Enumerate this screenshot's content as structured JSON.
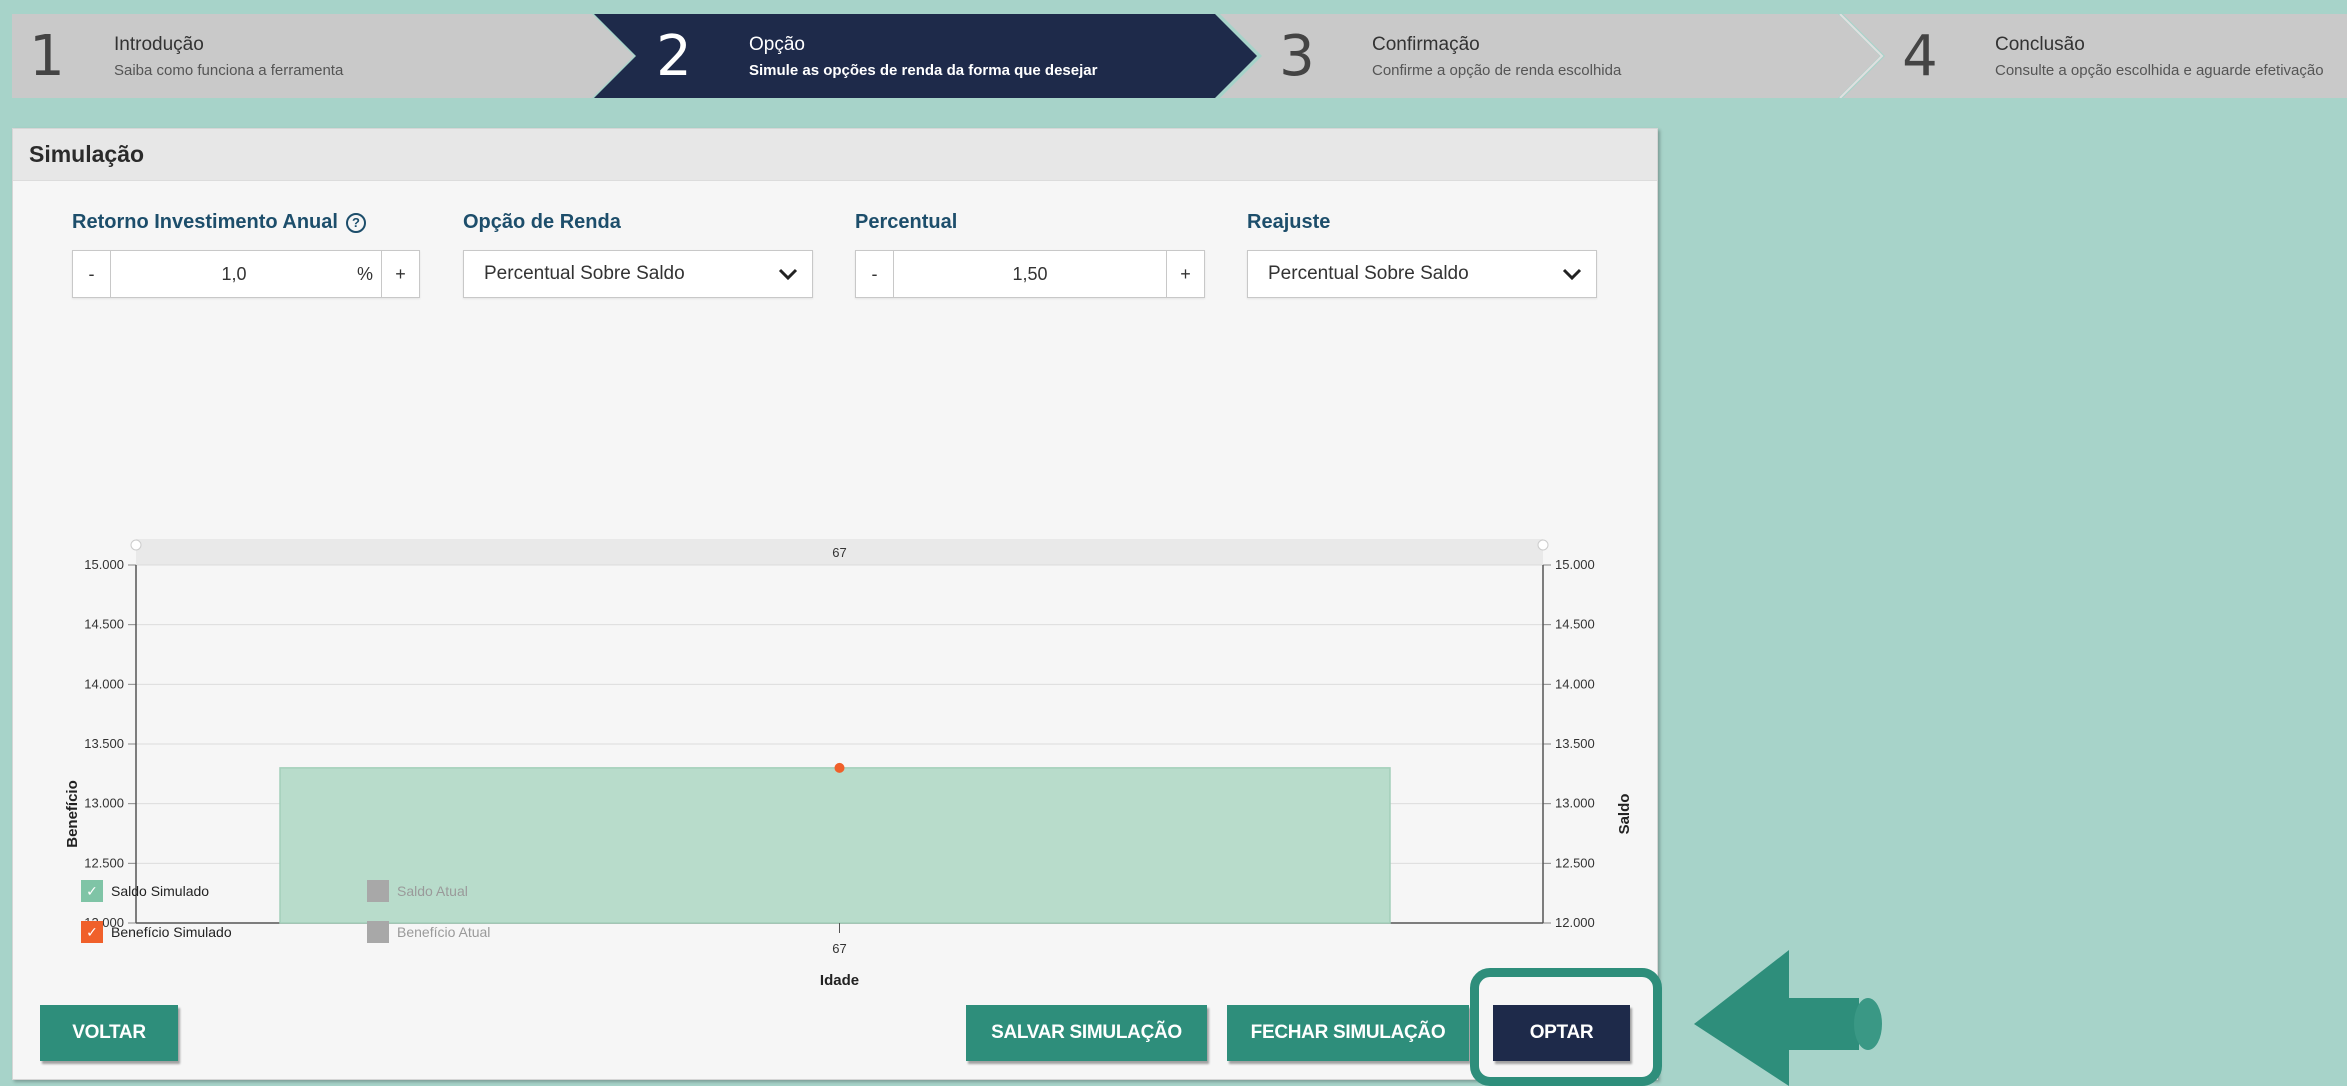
{
  "steps": [
    {
      "num": "1",
      "title": "Introdução",
      "sub": "Saiba como funciona a ferramenta"
    },
    {
      "num": "2",
      "title": "Opção",
      "sub": "Simule as opções de renda da forma que desejar"
    },
    {
      "num": "3",
      "title": "Confirmação",
      "sub": "Confirme a opção de renda escolhida"
    },
    {
      "num": "4",
      "title": "Conclusão",
      "sub": "Consulte a opção escolhida e aguarde efetivação"
    }
  ],
  "panel": {
    "title": "Simulação"
  },
  "fields": {
    "retorno": {
      "label": "Retorno Investimento Anual",
      "value": "1,0",
      "unit": "%",
      "minus": "-",
      "plus": "+"
    },
    "opcao": {
      "label": "Opção de Renda",
      "value": "Percentual Sobre Saldo"
    },
    "percentual": {
      "label": "Percentual",
      "value": "1,50",
      "minus": "-",
      "plus": "+"
    },
    "reajuste": {
      "label": "Reajuste",
      "value": "Percentual Sobre Saldo"
    }
  },
  "icons": {
    "help": "?",
    "check": "✓"
  },
  "chart_data": {
    "type": "bar",
    "categories": [
      "67"
    ],
    "top_label": "67",
    "xlabel": "Idade",
    "ylabel": "Benefício",
    "y2label": "Saldo",
    "ylim": [
      12000,
      15000
    ],
    "yticks": [
      "12.000",
      "12.500",
      "13.000",
      "13.500",
      "14.000",
      "14.500",
      "15.000"
    ],
    "series": [
      {
        "name": "Saldo Simulado",
        "type": "area",
        "values": [
          13300
        ],
        "color": "#b8dccb"
      },
      {
        "name": "Benefício Simulado",
        "type": "point",
        "values": [
          13300
        ],
        "color": "#f0602a"
      }
    ],
    "grid": true
  },
  "legend": [
    {
      "label": "Saldo Simulado",
      "color": "#7fc4a6",
      "checked": true
    },
    {
      "label": "Benefício Simulado",
      "color": "#f0602a",
      "checked": true
    },
    {
      "label": "Saldo Atual",
      "color": "#a8a8a8",
      "checked": false
    },
    {
      "label": "Benefício Atual",
      "color": "#a8a8a8",
      "checked": false
    }
  ],
  "buttons": {
    "voltar": "VOLTAR",
    "salvar": "SALVAR SIMULAÇÃO",
    "fechar": "FECHAR SIMULAÇÃO",
    "optar": "OPTAR"
  },
  "colors": {
    "active_step": "#1e2a4a",
    "inactive_step": "#c8c8c8",
    "teal": "#2e8e7b",
    "navy": "#1e2a4a"
  }
}
